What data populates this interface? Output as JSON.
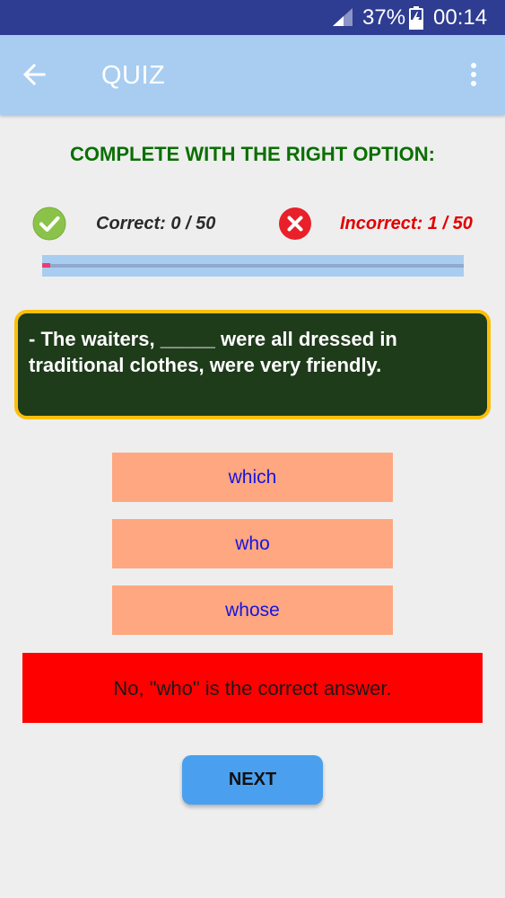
{
  "status_bar": {
    "battery_percent": "37%",
    "time": "00:14",
    "signal_icon": "signal-icon",
    "battery_icon": "battery-charging-icon"
  },
  "app_bar": {
    "title": "QUIZ",
    "back_icon": "arrow-left-icon",
    "menu_icon": "more-vertical-icon",
    "color": "#a8cdf1"
  },
  "quiz": {
    "instruction": "COMPLETE WITH THE RIGHT OPTION:",
    "correct_label": "Correct: 0 / 50",
    "incorrect_label": "Incorrect: 1 / 50",
    "correct_icon": "check-circle-icon",
    "incorrect_icon": "x-circle-icon",
    "progress": {
      "answered": 1,
      "total": 50
    },
    "question": "- The waiters, _____  were all dressed in traditional clothes, were very friendly.",
    "options": [
      {
        "label": "which"
      },
      {
        "label": "who"
      },
      {
        "label": "whose"
      }
    ],
    "feedback": "No, \"who\" is the correct answer.",
    "next_label": "NEXT"
  },
  "colors": {
    "instruction": "#0a6f00",
    "incorrect": "#e10000",
    "question_bg": "#1e3b1a",
    "question_border": "#fbbf0a",
    "option_bg": "#ffa780",
    "option_text": "#1515e0",
    "feedback_bg": "#ff0000",
    "next_bg": "#4aa0ef"
  }
}
